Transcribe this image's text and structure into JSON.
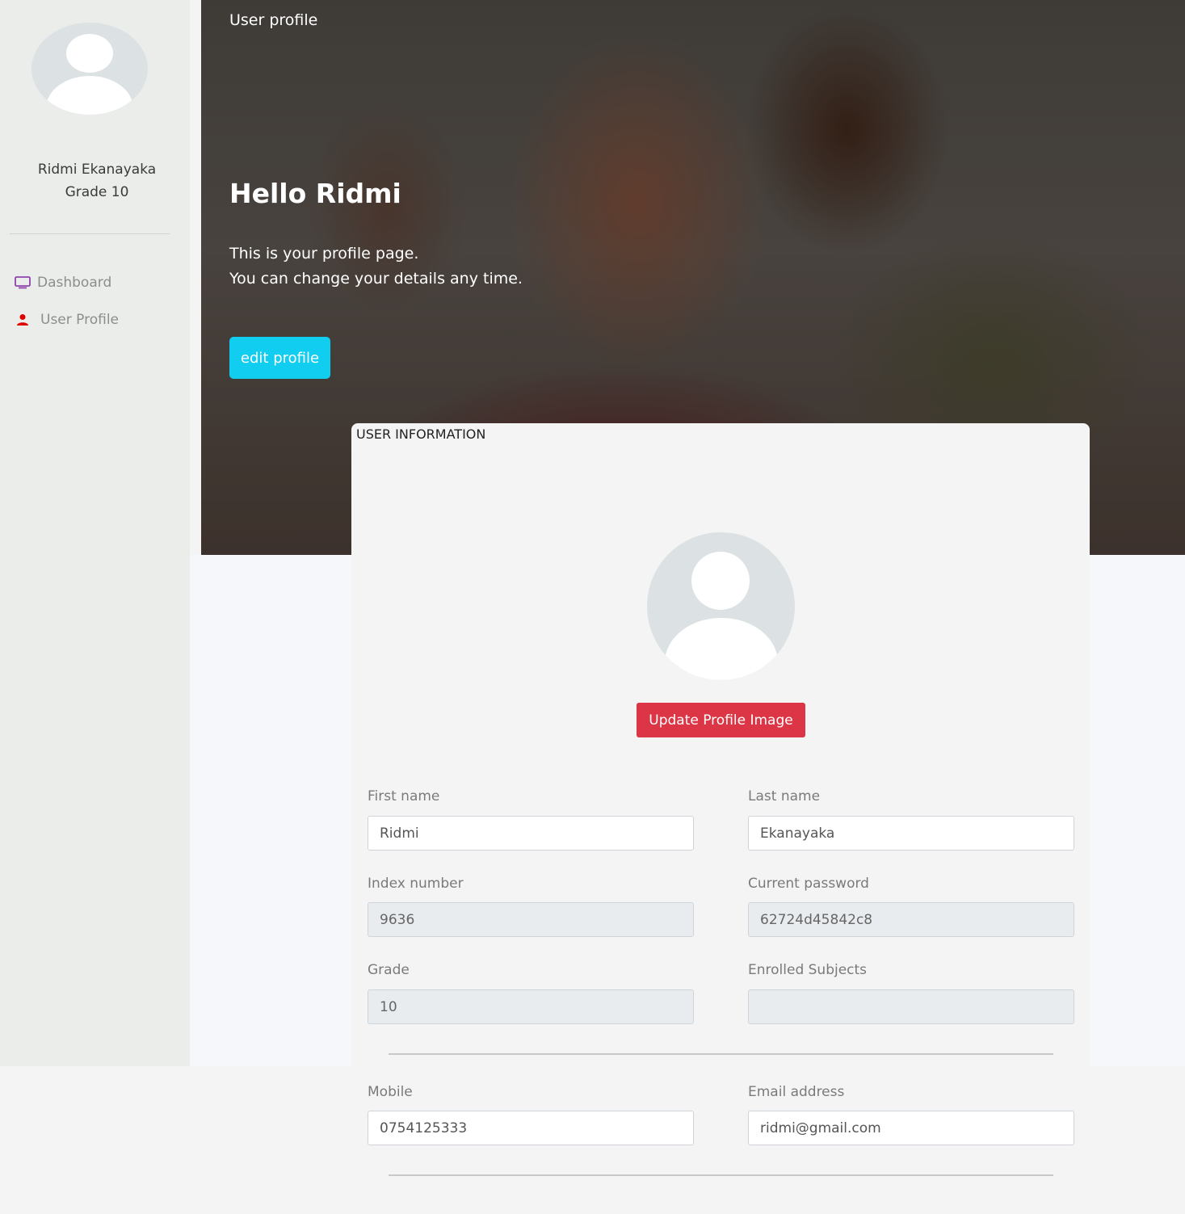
{
  "sidebar": {
    "user_name": "Ridmi Ekanayaka",
    "grade": "Grade 10",
    "nav": [
      {
        "label": "Dashboard",
        "icon": "monitor-icon",
        "color": "#8e44ad"
      },
      {
        "label": "User Profile",
        "icon": "user-icon",
        "color": "#e00000"
      }
    ]
  },
  "hero": {
    "topline": "User profile",
    "title": "Hello Ridmi",
    "line1": "This is your profile page.",
    "line2": "You can change your details any time.",
    "edit_button": "edit profile"
  },
  "card": {
    "header": "USER INFORMATION",
    "update_button": "Update Profile Image",
    "fields": {
      "first_name": {
        "label": "First name",
        "value": "Ridmi"
      },
      "last_name": {
        "label": "Last name",
        "value": "Ekanayaka"
      },
      "index_number": {
        "label": "Index number",
        "value": "9636"
      },
      "current_password": {
        "label": "Current password",
        "value": "62724d45842c8"
      },
      "grade": {
        "label": "Grade",
        "value": "10"
      },
      "enrolled_subjects": {
        "label": "Enrolled Subjects",
        "value": ""
      },
      "mobile": {
        "label": "Mobile",
        "value": "0754125333"
      },
      "email": {
        "label": "Email address",
        "value": "ridmi@gmail.com"
      }
    }
  },
  "colors": {
    "edit_button": "#11cdef",
    "update_button": "#dc3545",
    "sidebar_bg": "#ebedeb"
  }
}
